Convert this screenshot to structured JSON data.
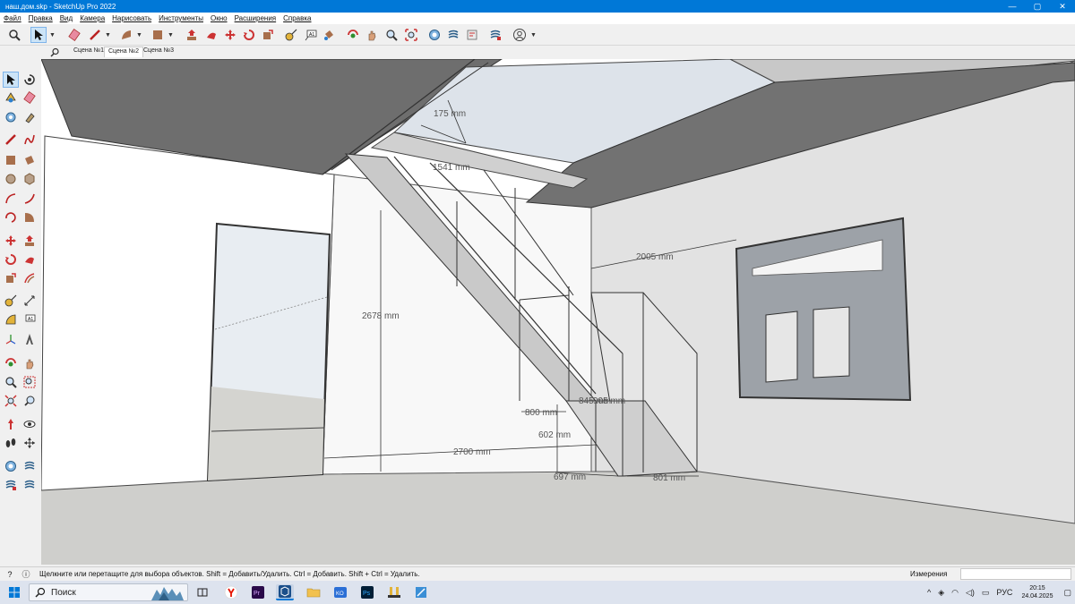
{
  "window": {
    "title": "наш.дом.skp - SketchUp Pro 2022",
    "controls": [
      "—",
      "▢",
      "✕"
    ]
  },
  "menu": [
    "Файл",
    "Правка",
    "Вид",
    "Камера",
    "Нарисовать",
    "Инструменты",
    "Окно",
    "Расширения",
    "Справка"
  ],
  "scenes": [
    {
      "label": "Сцена №1",
      "active": false
    },
    {
      "label": "Сцена №2",
      "active": true
    },
    {
      "label": "Сцена №3",
      "active": false
    }
  ],
  "dimensions": {
    "d1": "175 mm",
    "d2": "1541 mm",
    "d3": "2005 mm",
    "d4": "2678 mm",
    "d5": "800 mm",
    "d6": "845 mm",
    "d7": "905 mm",
    "d8": "602 mm",
    "d9": "2700 mm",
    "d10": "697 mm",
    "d11": "801 mm"
  },
  "status": {
    "hint": "Щелкните или перетащите для выбора объектов. Shift = Добавить/Удалить. Ctrl = Добавить. Shift + Ctrl = Удалить.",
    "measurements_label": "Измерения",
    "measurements_value": ""
  },
  "taskbar": {
    "search_placeholder": "Поиск",
    "language": "РУС",
    "time": "20:15",
    "date": "24.04.2025"
  },
  "colors": {
    "titlebar": "#0078d7",
    "ceiling_dark": "#6e6e6e",
    "floor": "#cfcfcc",
    "wall_right": "#e2e2e2",
    "sky": "#dde3ea"
  }
}
